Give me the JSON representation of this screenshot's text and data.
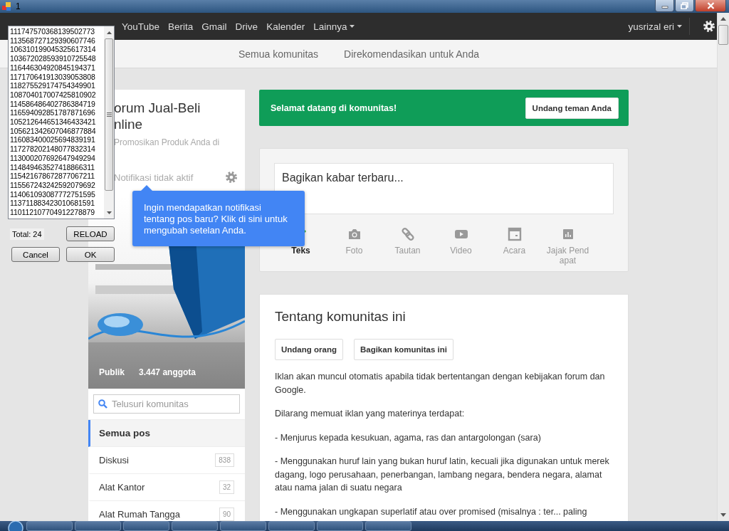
{
  "window": {
    "title": "1"
  },
  "dialog": {
    "items": [
      "11174757036813950277​3",
      "11356872712939060774​6",
      "10631019904532561731​4",
      "10367202859391072554​8",
      "11644630492084519437​1",
      "11717064191303905380​8",
      "11827552917475434990​1",
      "10870401700742581090​2",
      "11458648640278638471​9",
      "11659409285178787169​6",
      "10521264465134643342​1",
      "10562134260704687788​4",
      "11608340002569483919​1",
      "11727820214807783231​4",
      "11300020769264794929​4",
      "11484946352741886631​1",
      "11542167867287706721​1",
      "11556724324259207969​2",
      "11406109308777275159​5",
      "11371188342301068159​1",
      "11011210770491227887​9"
    ],
    "total": "Total: 24",
    "buttons": [
      {
        "label": "RELOAD"
      },
      {
        "label": "Cancel"
      },
      {
        "label": "OK"
      }
    ]
  },
  "nav": {
    "links": [
      {
        "label": "YouTube"
      },
      {
        "label": "Berita"
      },
      {
        "label": "Gmail"
      },
      {
        "label": "Drive"
      },
      {
        "label": "Kalender"
      },
      {
        "label": "Lainnya",
        "dropdown": true
      }
    ],
    "user": "yusrizal eri"
  },
  "subnav": {
    "tabs": [
      {
        "label": "Semua komunitas"
      },
      {
        "label": "Direkomendasikan untuk Anda"
      }
    ]
  },
  "community": {
    "title_lines": [
      "orum Jual-Beli",
      "nline"
    ],
    "tagline": "Promosikan Produk Anda di",
    "notification": "Notifikasi tidak aktif",
    "tooltip": "Ingin mendapatkan notifikasi tentang pos baru? Klik di sini untuk mengubah setelan Anda.",
    "banner": {
      "kind": "picture",
      "visibility": "Publik",
      "members": "3.447 anggota"
    },
    "search": {
      "placeholder": "Telusuri komunitas"
    },
    "categories": [
      {
        "label": "Semua pos",
        "selected": true
      },
      {
        "label": "Diskusi",
        "count": "838",
        "selected": false
      },
      {
        "label": "Alat Kantor",
        "count": "32",
        "selected": false
      },
      {
        "label": "Alat Rumah Tangga",
        "count": "90",
        "selected": false
      }
    ]
  },
  "welcome": {
    "text": "Selamat datang di komunitas!",
    "button": "Undang teman Anda"
  },
  "share": {
    "placeholder": "Bagikan kabar terbaru...",
    "actions": [
      {
        "label": "Teks",
        "kind": "pencil",
        "selected": true
      },
      {
        "label": "Foto",
        "kind": "camera",
        "selected": false
      },
      {
        "label": "Tautan",
        "kind": "link",
        "selected": false
      },
      {
        "label": "Video",
        "kind": "video",
        "selected": false
      },
      {
        "label": "Acara",
        "kind": "calendar",
        "selected": false
      },
      {
        "label": "Jajak Pendapat",
        "kind": "chart",
        "selected": false
      }
    ]
  },
  "about": {
    "title": "Tentang komunitas ini",
    "buttons": [
      "Undang orang",
      "Bagikan komunitas ini"
    ],
    "paragraphs": [
      "Iklan akan muncul otomatis apabila tidak bertentangan dengan kebijakan forum dan Google.",
      "Dilarang memuat iklan yang materinya terdapat:",
      "- Menjurus kepada kesukuan, agama, ras dan antargolongan (sara)",
      "- Menggunakan huruf lain yang bukan huruf latin, kecuali jika digunakan untuk merek dagang, logo perusahaan, penerbangan, lambang negara, bendera negara, alamat atau nama jalan di suatu negara",
      "- Menggunakan ungkapan superlatif atau over promised (misalnya : ter... paling"
    ]
  }
}
